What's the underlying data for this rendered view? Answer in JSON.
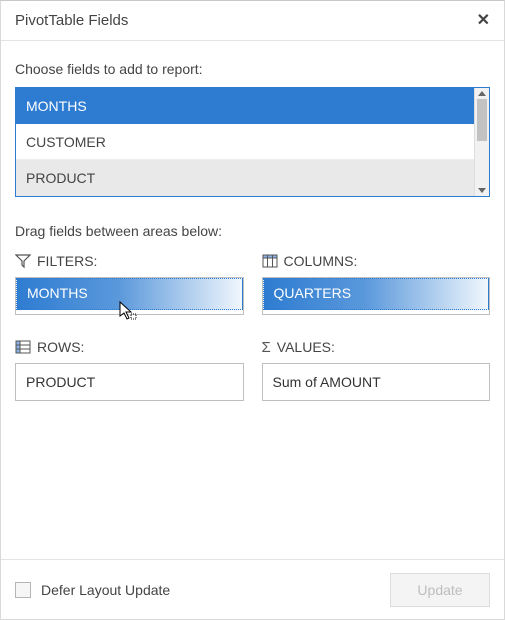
{
  "header": {
    "title": "PivotTable Fields"
  },
  "chooseLabel": "Choose fields to add to report:",
  "fields": {
    "items": [
      {
        "label": "MONTHS",
        "selected": true
      },
      {
        "label": "CUSTOMER",
        "selected": false
      },
      {
        "label": "PRODUCT",
        "selected": false
      }
    ]
  },
  "dragLabel": "Drag fields between areas below:",
  "areas": {
    "filters": {
      "title": "FILTERS:",
      "ghost": "MONTHS"
    },
    "columns": {
      "title": "COLUMNS:",
      "ghost": "QUARTERS"
    },
    "rows": {
      "title": "ROWS:",
      "entry": "PRODUCT"
    },
    "values": {
      "title": "VALUES:",
      "entry": "Sum of AMOUNT"
    }
  },
  "footer": {
    "deferLabel": "Defer Layout Update",
    "deferChecked": false,
    "updateLabel": "Update",
    "updateEnabled": false
  }
}
